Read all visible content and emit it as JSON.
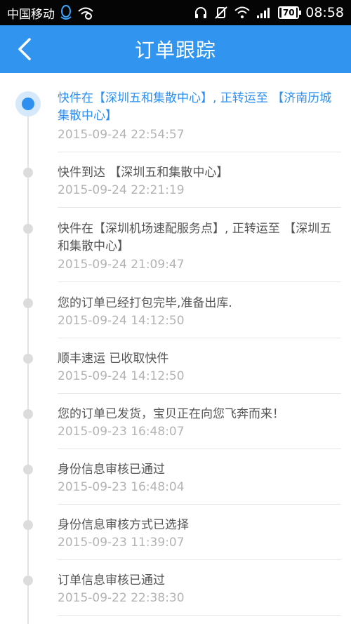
{
  "status_bar": {
    "carrier": "中国移动",
    "battery": "70",
    "time": "08:58",
    "icons": [
      "qq-icon",
      "wifi-hotspot-icon",
      "headset-icon",
      "mute-icon",
      "wifi-icon",
      "signal-icon",
      "battery-icon"
    ]
  },
  "header": {
    "title": "订单跟踪",
    "back_icon": "chevron-left-icon"
  },
  "colors": {
    "accent": "#3195f0",
    "active_text": "#2d8ff0",
    "body_text": "#555555",
    "time_text": "#b3b3b3"
  },
  "tracking": [
    {
      "text": "快件在【深圳五和集散中心】, 正转运至 【济南历城集散中心】",
      "time": "2015-09-24 22:54:57",
      "active": true
    },
    {
      "text": "快件到达 【深圳五和集散中心】",
      "time": "2015-09-24 22:21:19",
      "active": false
    },
    {
      "text": "快件在【深圳机场速配服务点】, 正转运至 【深圳五和集散中心】",
      "time": "2015-09-24 21:09:47",
      "active": false
    },
    {
      "text": "您的订单已经打包完毕,准备出库.",
      "time": "2015-09-24 14:12:50",
      "active": false
    },
    {
      "text": "顺丰速运 已收取快件",
      "time": "2015-09-24 14:12:50",
      "active": false
    },
    {
      "text": "您的订单已发货，宝贝正在向您飞奔而来！",
      "time": "2015-09-23 16:48:07",
      "active": false
    },
    {
      "text": "身份信息审核已通过",
      "time": "2015-09-23 16:48:04",
      "active": false
    },
    {
      "text": "身份信息审核方式已选择",
      "time": "2015-09-23 11:39:07",
      "active": false
    },
    {
      "text": "订单信息审核已通过",
      "time": "2015-09-22 22:38:30",
      "active": false
    }
  ]
}
